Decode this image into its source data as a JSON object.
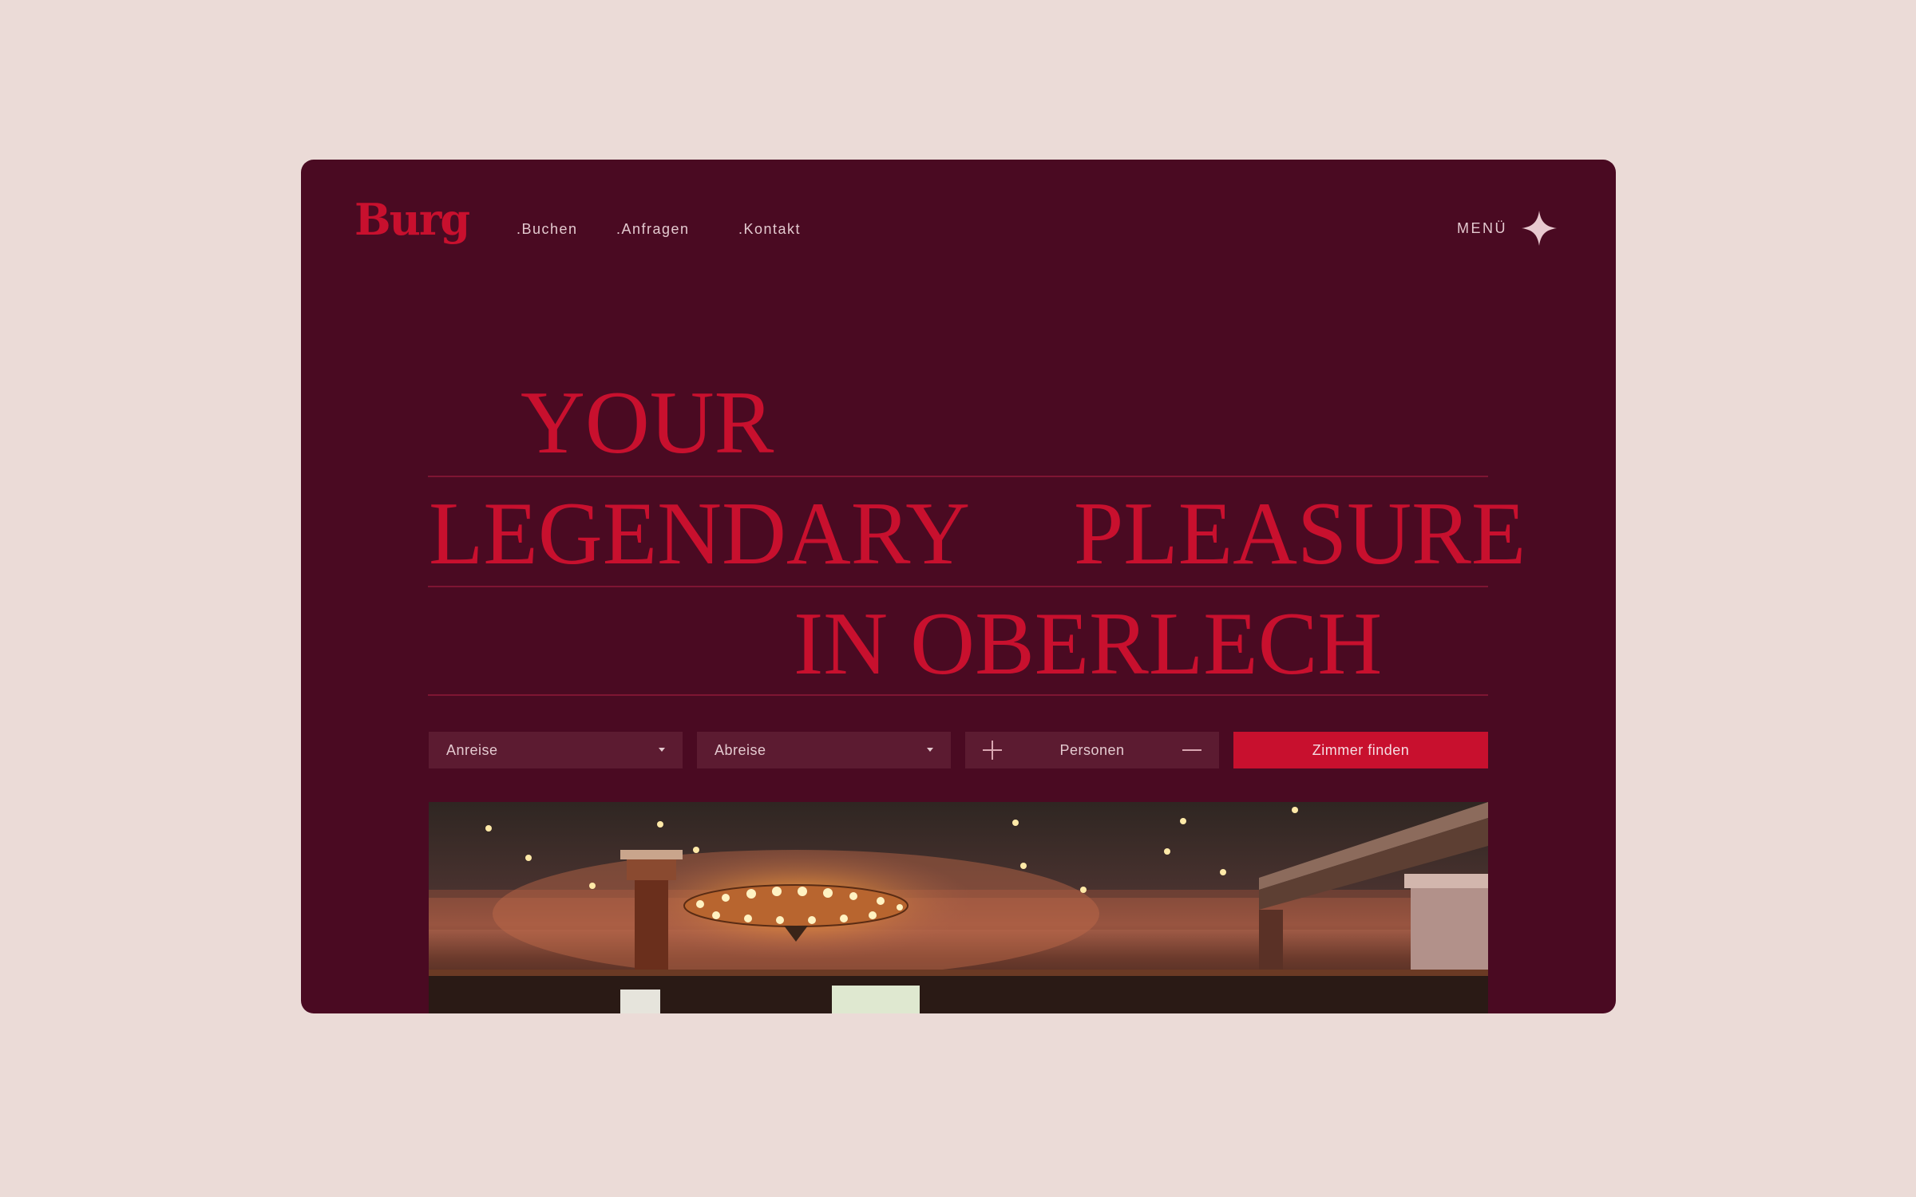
{
  "brand": {
    "logo": "Burg",
    "accent_color": "#c8102e",
    "background_color": "#4a0a22",
    "page_background": "#ebdbd7"
  },
  "nav": {
    "links": [
      ".Buchen",
      ".Anfragen",
      ".Kontakt"
    ],
    "menu_label": "MENÜ",
    "menu_icon": "four-point-star-icon"
  },
  "hero": {
    "line1": "YOUR",
    "line2_left": "LEGENDARY",
    "line2_right": "PLEASURE",
    "line3": "IN OBERLECH"
  },
  "booking": {
    "arrival_label": "Anreise",
    "departure_label": "Abreise",
    "persons_label": "Personen",
    "submit_label": "Zimmer finden"
  }
}
